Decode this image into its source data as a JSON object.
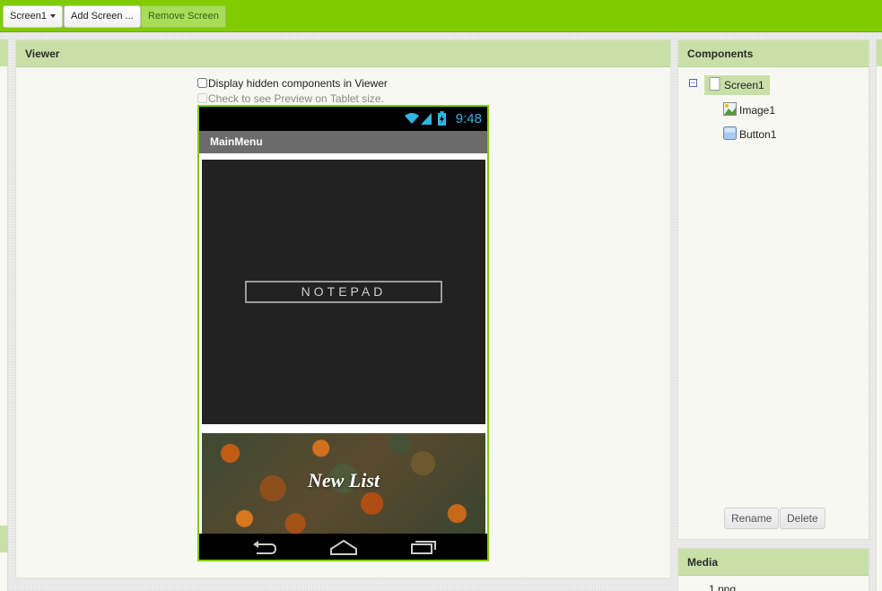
{
  "toolbar": {
    "screen_select": "Screen1",
    "add_screen": "Add Screen ...",
    "remove_screen": "Remove Screen"
  },
  "viewer": {
    "title": "Viewer",
    "show_hidden_label": "Display hidden components in Viewer",
    "tablet_preview_label": "Check to see Preview on Tablet size."
  },
  "phone": {
    "status_time": "9:48",
    "title": "MainMenu",
    "image_text": "NOTEPAD",
    "button_text": "New List"
  },
  "components": {
    "title": "Components",
    "tree": [
      {
        "label": "Screen1",
        "icon": "screen-icon",
        "selected": true
      },
      {
        "label": "Image1",
        "icon": "image-icon"
      },
      {
        "label": "Button1",
        "icon": "button-icon"
      }
    ],
    "rename_label": "Rename",
    "delete_label": "Delete"
  },
  "media": {
    "title": "Media",
    "files": [
      "1.png"
    ]
  },
  "colors": {
    "accent": "#80cc00",
    "header": "#c8e0a8",
    "status_time": "#33b5e5"
  }
}
